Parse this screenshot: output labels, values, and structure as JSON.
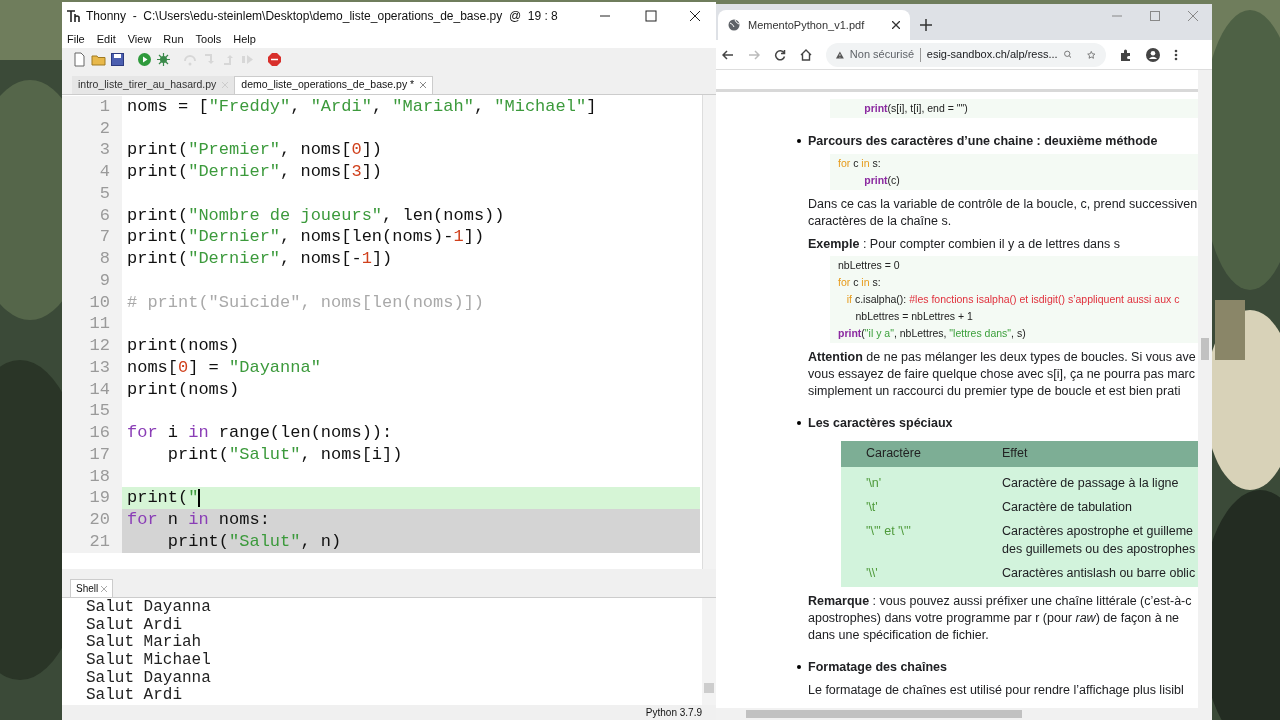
{
  "thonny": {
    "title": "Thonny  -  C:\\Users\\edu-steinlem\\Desktop\\demo_liste_operations_de_base.py  @  19 : 8",
    "menu": [
      "File",
      "Edit",
      "View",
      "Run",
      "Tools",
      "Help"
    ],
    "toolbar": [
      {
        "kind": "new",
        "disabled": false
      },
      {
        "kind": "open",
        "disabled": false
      },
      {
        "kind": "save",
        "disabled": false
      },
      {
        "kind": "run",
        "disabled": false
      },
      {
        "kind": "debug",
        "disabled": false
      },
      {
        "kind": "step_over",
        "disabled": true
      },
      {
        "kind": "step_into",
        "disabled": true
      },
      {
        "kind": "step_out",
        "disabled": true
      },
      {
        "kind": "resume",
        "disabled": true
      },
      {
        "kind": "stop",
        "disabled": false
      }
    ],
    "tabs": [
      {
        "label": "intro_liste_tirer_au_hasard.py",
        "selected": false
      },
      {
        "label": "demo_liste_operations_de_base.py *",
        "selected": true
      }
    ],
    "editor": {
      "lines": [
        {
          "number": "1",
          "segments": [
            {
              "text": "noms = [",
              "kind": "plain"
            },
            {
              "text": "\"Freddy\"",
              "kind": "string"
            },
            {
              "text": ", ",
              "kind": "plain"
            },
            {
              "text": "\"Ardi\"",
              "kind": "string"
            },
            {
              "text": ", ",
              "kind": "plain"
            },
            {
              "text": "\"Mariah\"",
              "kind": "string"
            },
            {
              "text": ", ",
              "kind": "plain"
            },
            {
              "text": "\"Michael\"",
              "kind": "string"
            },
            {
              "text": "]",
              "kind": "plain"
            }
          ]
        },
        {
          "number": "2"
        },
        {
          "number": "3",
          "segments": [
            {
              "text": "print(",
              "kind": "plain"
            },
            {
              "text": "\"Premier\"",
              "kind": "string"
            },
            {
              "text": ", noms[",
              "kind": "plain"
            },
            {
              "text": "0",
              "kind": "number"
            },
            {
              "text": "])",
              "kind": "plain"
            }
          ]
        },
        {
          "number": "4",
          "segments": [
            {
              "text": "print(",
              "kind": "plain"
            },
            {
              "text": "\"Dernier\"",
              "kind": "string"
            },
            {
              "text": ", noms[",
              "kind": "plain"
            },
            {
              "text": "3",
              "kind": "number"
            },
            {
              "text": "])",
              "kind": "plain"
            }
          ]
        },
        {
          "number": "5"
        },
        {
          "number": "6",
          "segments": [
            {
              "text": "print(",
              "kind": "plain"
            },
            {
              "text": "\"Nombre de joueurs\"",
              "kind": "string"
            },
            {
              "text": ", len(noms))",
              "kind": "plain"
            }
          ]
        },
        {
          "number": "7",
          "segments": [
            {
              "text": "print(",
              "kind": "plain"
            },
            {
              "text": "\"Dernier\"",
              "kind": "string"
            },
            {
              "text": ", noms[len(noms)-",
              "kind": "plain"
            },
            {
              "text": "1",
              "kind": "number"
            },
            {
              "text": "])",
              "kind": "plain"
            }
          ]
        },
        {
          "number": "8",
          "segments": [
            {
              "text": "print(",
              "kind": "plain"
            },
            {
              "text": "\"Dernier\"",
              "kind": "string"
            },
            {
              "text": ", noms[-",
              "kind": "plain"
            },
            {
              "text": "1",
              "kind": "number"
            },
            {
              "text": "])",
              "kind": "plain"
            }
          ]
        },
        {
          "number": "9"
        },
        {
          "number": "10",
          "segments": [
            {
              "text": "# print(\"Suicide\", noms[len(noms)])",
              "kind": "comment"
            }
          ]
        },
        {
          "number": "11"
        },
        {
          "number": "12",
          "segments": [
            {
              "text": "print(noms)",
              "kind": "plain"
            }
          ]
        },
        {
          "number": "13",
          "segments": [
            {
              "text": "noms[",
              "kind": "plain"
            },
            {
              "text": "0",
              "kind": "number"
            },
            {
              "text": "] = ",
              "kind": "plain"
            },
            {
              "text": "\"Dayanna\"",
              "kind": "string"
            }
          ]
        },
        {
          "number": "14",
          "segments": [
            {
              "text": "print(noms)",
              "kind": "plain"
            }
          ]
        },
        {
          "number": "15"
        },
        {
          "number": "16",
          "segments": [
            {
              "text": "for",
              "kind": "keyword"
            },
            {
              "text": " i ",
              "kind": "plain"
            },
            {
              "text": "in",
              "kind": "keyword"
            },
            {
              "text": " range(len(noms)):",
              "kind": "plain"
            }
          ]
        },
        {
          "number": "17",
          "segments": [
            {
              "text": "    print(",
              "kind": "plain"
            },
            {
              "text": "\"Salut\"",
              "kind": "string"
            },
            {
              "text": ", noms[i])",
              "kind": "plain"
            }
          ]
        },
        {
          "number": "18"
        },
        {
          "number": "19",
          "selected": false,
          "caret": true,
          "segments": [
            {
              "text": "print(",
              "kind": "plain"
            },
            {
              "text": "\"",
              "kind": "string"
            }
          ]
        },
        {
          "number": "20",
          "selected": true,
          "segments": [
            {
              "text": "for",
              "kind": "keyword"
            },
            {
              "text": " n ",
              "kind": "plain"
            },
            {
              "text": "in",
              "kind": "keyword"
            },
            {
              "text": " noms:",
              "kind": "plain"
            }
          ]
        },
        {
          "number": "21",
          "selected": true,
          "segments": [
            {
              "text": "    print(",
              "kind": "plain"
            },
            {
              "text": "\"Salut\"",
              "kind": "string"
            },
            {
              "text": ", n)",
              "kind": "plain"
            }
          ]
        }
      ]
    },
    "shell": {
      "tab": "Shell",
      "lines": [
        "Salut Dayanna",
        "Salut Ardi",
        "Salut Mariah",
        "Salut Michael",
        "Salut Dayanna",
        "Salut Ardi"
      ]
    },
    "status": "Python 3.7.9"
  },
  "browser": {
    "tab_title": "MementoPython_v1.pdf",
    "security": "Non sécurisé",
    "url": "esig-sandbox.ch/alp/ress...",
    "document": [
      {
        "kind": "code",
        "lines": [
          [
            {
              "text": "         print",
              "kind": "builtin"
            },
            {
              "text": "(s[i], t[i], end = \"\")",
              "kind": "plain"
            }
          ]
        ]
      },
      {
        "kind": "heading",
        "text": "Parcours des caractères d’une chaine : deuxième méthode"
      },
      {
        "kind": "code",
        "lines": [
          [
            {
              "text": "for",
              "kind": "keyword"
            },
            {
              "text": " c ",
              "kind": "plain"
            },
            {
              "text": "in",
              "kind": "keyword"
            },
            {
              "text": " s:",
              "kind": "plain"
            }
          ],
          [
            {
              "text": "         print",
              "kind": "builtin"
            },
            {
              "text": "(c)",
              "kind": "plain"
            }
          ]
        ]
      },
      {
        "kind": "paragraph",
        "lines": [
          "Dans ce cas la variable de contrôle de la boucle, c, prend successiven",
          "caractères de la chaîne s."
        ]
      },
      {
        "kind": "paragraph",
        "lines": [
          "**Exemple** : Pour compter combien il y a de lettres dans s"
        ]
      },
      {
        "kind": "code",
        "lines": [
          [
            {
              "text": "nbLettres = 0",
              "kind": "plain"
            }
          ],
          [
            {
              "text": "for",
              "kind": "keyword"
            },
            {
              "text": " c ",
              "kind": "plain"
            },
            {
              "text": "in",
              "kind": "keyword"
            },
            {
              "text": " s:",
              "kind": "plain"
            }
          ],
          [
            {
              "text": "   if",
              "kind": "keyword"
            },
            {
              "text": " c.isalpha(): ",
              "kind": "plain"
            },
            {
              "text": "#les fonctions isalpha() et isdigit() s’appliquent aussi aux c",
              "kind": "comment"
            }
          ],
          [
            {
              "text": "      nbLettres = nbLettres + 1",
              "kind": "plain"
            }
          ],
          [
            {
              "text": "print",
              "kind": "builtin"
            },
            {
              "text": "(",
              "kind": "plain"
            },
            {
              "text": "\"il y a\"",
              "kind": "string"
            },
            {
              "text": ", nbLettres, ",
              "kind": "plain"
            },
            {
              "text": "\"lettres dans\"",
              "kind": "string"
            },
            {
              "text": ", s)",
              "kind": "plain"
            }
          ]
        ]
      },
      {
        "kind": "paragraph",
        "lines": [
          "**Attention** de ne pas mélanger les deux types de boucles. Si vous ave",
          "vous essayez de faire quelque chose avec s[i], ça ne pourra pas marc",
          "simplement un raccourci du premier type de boucle et est bien prati"
        ]
      },
      {
        "kind": "heading",
        "text": "Les caractères spéciaux"
      },
      {
        "kind": "table",
        "columns": [
          "Caractère",
          "Effet"
        ],
        "rows": [
          [
            "'\\n'",
            "Caractère de passage à la ligne"
          ],
          [
            "'\\t'",
            "Caractère de tabulation"
          ],
          [
            "\"\\'\" et '\\\"'",
            "Caractères apostrophe et guilleme\ndes guillemets ou des apostrophes"
          ],
          [
            "'\\\\'",
            "Caractères antislash ou barre oblic"
          ]
        ]
      },
      {
        "kind": "paragraph",
        "lines": [
          "**Remarque** : vous pouvez aussi préfixer une chaîne littérale (c’est-à-c",
          "apostrophes) dans votre programme par r (pour *raw*) de façon à ne",
          "dans une spécification de fichier."
        ]
      },
      {
        "kind": "heading",
        "text": "Formatage des chaînes"
      },
      {
        "kind": "paragraph",
        "lines": [
          "Le formatage de chaînes est utilisé pour rendre l’affichage plus lisibl"
        ]
      }
    ]
  }
}
